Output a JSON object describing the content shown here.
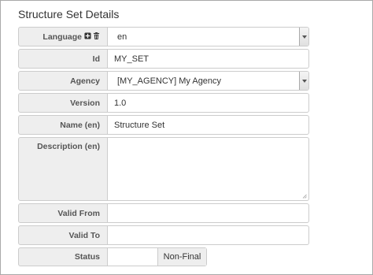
{
  "title": "Structure Set Details",
  "fields": {
    "language": {
      "label": "Language",
      "value": "en"
    },
    "id": {
      "label": "Id",
      "value": "MY_SET"
    },
    "agency": {
      "label": "Agency",
      "value": "[MY_AGENCY] My Agency"
    },
    "version": {
      "label": "Version",
      "value": "1.0"
    },
    "name": {
      "label": "Name (en)",
      "value": "Structure Set"
    },
    "description": {
      "label": "Description (en)",
      "value": ""
    },
    "valid_from": {
      "label": "Valid From",
      "value": ""
    },
    "valid_to": {
      "label": "Valid To",
      "value": ""
    },
    "status": {
      "label": "Status",
      "value": "Non-Final"
    }
  },
  "icons": {
    "add_language": "plus-square-icon",
    "delete_language": "trash-icon",
    "dropdown": "caret-down-icon"
  },
  "colors": {
    "label_bg": "#eeeeee",
    "border": "#cccccc",
    "label_text": "#555555"
  }
}
